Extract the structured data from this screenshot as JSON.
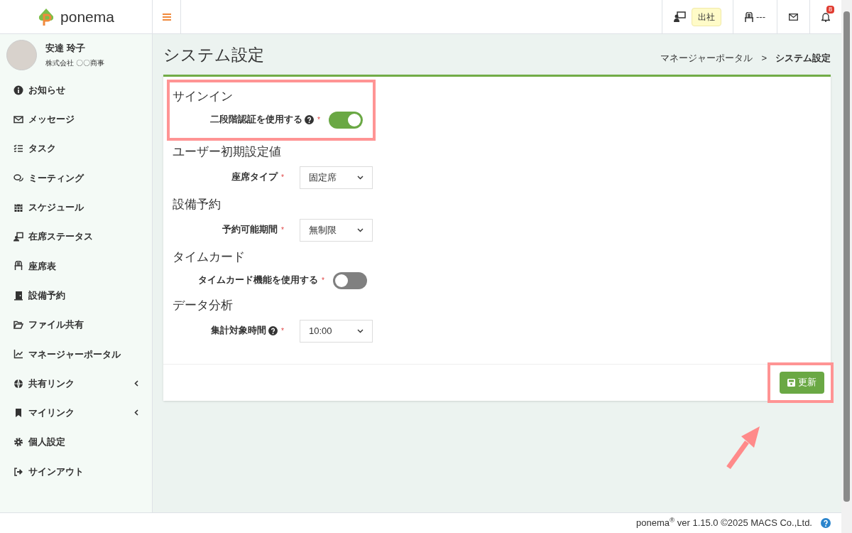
{
  "brand": {
    "name": "ponema"
  },
  "header": {
    "status_label": "出社",
    "seat": "---",
    "notification_count": "8"
  },
  "user": {
    "name": "安達 玲子",
    "company": "株式会社 〇〇商事"
  },
  "sidebar": {
    "items": [
      {
        "label": "お知らせ",
        "expandable": false
      },
      {
        "label": "メッセージ",
        "expandable": false
      },
      {
        "label": "タスク",
        "expandable": false
      },
      {
        "label": "ミーティング",
        "expandable": false
      },
      {
        "label": "スケジュール",
        "expandable": false
      },
      {
        "label": "在席ステータス",
        "expandable": false
      },
      {
        "label": "座席表",
        "expandable": false
      },
      {
        "label": "設備予約",
        "expandable": false
      },
      {
        "label": "ファイル共有",
        "expandable": false
      },
      {
        "label": "マネージャーポータル",
        "expandable": false
      },
      {
        "label": "共有リンク",
        "expandable": true
      },
      {
        "label": "マイリンク",
        "expandable": true
      },
      {
        "label": "個人設定",
        "expandable": false
      },
      {
        "label": "サインアウト",
        "expandable": false
      }
    ]
  },
  "page": {
    "title": "システム設定",
    "breadcrumb": [
      "マネージャーポータル",
      ">",
      "システム設定"
    ]
  },
  "sections": [
    {
      "title": "サインイン",
      "highlighted": true,
      "fields": [
        {
          "kind": "toggle",
          "label": "二段階認証を使用する",
          "help": true,
          "required_mark": "*",
          "on": true
        }
      ]
    },
    {
      "title": "ユーザー初期設定値",
      "highlighted": false,
      "fields": [
        {
          "kind": "select",
          "label": "座席タイプ",
          "help": false,
          "required_mark": "*",
          "value": "固定席"
        }
      ]
    },
    {
      "title": "設備予約",
      "highlighted": false,
      "fields": [
        {
          "kind": "select",
          "label": "予約可能期間",
          "help": false,
          "required_mark": "*",
          "value": "無制限"
        }
      ]
    },
    {
      "title": "タイムカード",
      "highlighted": false,
      "fields": [
        {
          "kind": "toggle",
          "label": "タイムカード機能を使用する",
          "help": false,
          "required_mark": "*",
          "on": false
        }
      ]
    },
    {
      "title": "データ分析",
      "highlighted": false,
      "fields": [
        {
          "kind": "select",
          "label": "集計対象時間",
          "help": true,
          "required_mark": "*",
          "value": "10:00"
        }
      ]
    }
  ],
  "save_button": {
    "label": "更新",
    "highlighted": true
  },
  "footer": {
    "text": "ponema$^{®}$ ver 1.15.0 ©2025 MACS Co.,Ltd."
  }
}
